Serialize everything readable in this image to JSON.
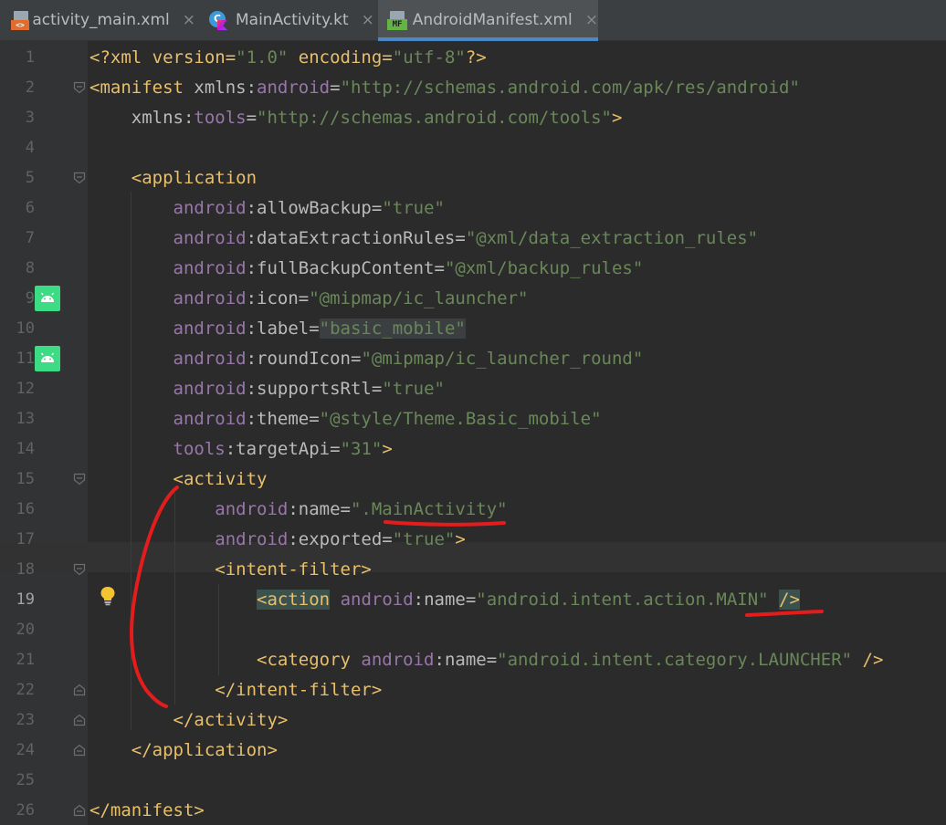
{
  "tabs": [
    {
      "label": "activity_main.xml",
      "icon": "xml-file-icon",
      "closable": true,
      "active": false
    },
    {
      "label": "MainActivity.kt",
      "icon": "kotlin-class-icon",
      "closable": true,
      "active": false
    },
    {
      "label": "AndroidManifest.xml",
      "icon": "manifest-file-icon",
      "closable": true,
      "active": true
    }
  ],
  "close_glyph": "×",
  "editor": {
    "current_line": 19,
    "line_numbers": [
      "1",
      "2",
      "3",
      "4",
      "5",
      "6",
      "7",
      "8",
      "9",
      "10",
      "11",
      "12",
      "13",
      "14",
      "15",
      "16",
      "17",
      "18",
      "19",
      "20",
      "21",
      "22",
      "23",
      "24",
      "25",
      "26"
    ],
    "lines": [
      [
        {
          "c": "pi",
          "t": "<?xml version="
        },
        {
          "c": "val",
          "t": "\"1.0\""
        },
        {
          "c": "pi",
          "t": " encoding="
        },
        {
          "c": "val",
          "t": "\"utf-8\""
        },
        {
          "c": "pi",
          "t": "?>"
        }
      ],
      [
        {
          "c": "tag",
          "t": "<manifest "
        },
        {
          "c": "attr",
          "t": "xmlns:"
        },
        {
          "c": "ns",
          "t": "android"
        },
        {
          "c": "attr",
          "t": "="
        },
        {
          "c": "val",
          "t": "\"http://schemas.android.com/apk/res/android\""
        }
      ],
      [
        {
          "c": "attr",
          "t": "    xmlns:"
        },
        {
          "c": "ns",
          "t": "tools"
        },
        {
          "c": "attr",
          "t": "="
        },
        {
          "c": "val",
          "t": "\"http://schemas.android.com/tools\""
        },
        {
          "c": "tag",
          "t": ">"
        }
      ],
      [],
      [
        {
          "c": "tag",
          "t": "    <application"
        }
      ],
      [
        {
          "c": "ns",
          "t": "        android"
        },
        {
          "c": "attr",
          "t": ":allowBackup="
        },
        {
          "c": "val",
          "t": "\"true\""
        }
      ],
      [
        {
          "c": "ns",
          "t": "        android"
        },
        {
          "c": "attr",
          "t": ":dataExtractionRules="
        },
        {
          "c": "val",
          "t": "\"@xml/data_extraction_rules\""
        }
      ],
      [
        {
          "c": "ns",
          "t": "        android"
        },
        {
          "c": "attr",
          "t": ":fullBackupContent="
        },
        {
          "c": "val",
          "t": "\"@xml/backup_rules\""
        }
      ],
      [
        {
          "c": "ns",
          "t": "        android"
        },
        {
          "c": "attr",
          "t": ":icon="
        },
        {
          "c": "val",
          "t": "\"@mipmap/ic_launcher\""
        }
      ],
      [
        {
          "c": "ns",
          "t": "        android"
        },
        {
          "c": "attr",
          "t": ":label="
        },
        {
          "c": "valbox",
          "t": "\"basic_mobile\""
        }
      ],
      [
        {
          "c": "ns",
          "t": "        android"
        },
        {
          "c": "attr",
          "t": ":roundIcon="
        },
        {
          "c": "val",
          "t": "\"@mipmap/ic_launcher_round\""
        }
      ],
      [
        {
          "c": "ns",
          "t": "        android"
        },
        {
          "c": "attr",
          "t": ":supportsRtl="
        },
        {
          "c": "val",
          "t": "\"true\""
        }
      ],
      [
        {
          "c": "ns",
          "t": "        android"
        },
        {
          "c": "attr",
          "t": ":theme="
        },
        {
          "c": "val",
          "t": "\"@style/Theme.Basic_mobile\""
        }
      ],
      [
        {
          "c": "ns",
          "t": "        tools"
        },
        {
          "c": "attr",
          "t": ":targetApi="
        },
        {
          "c": "val",
          "t": "\"31\""
        },
        {
          "c": "tag",
          "t": ">"
        }
      ],
      [
        {
          "c": "tag",
          "t": "        <activity"
        }
      ],
      [
        {
          "c": "ns",
          "t": "            android"
        },
        {
          "c": "attr",
          "t": ":name="
        },
        {
          "c": "val",
          "t": "\".MainActivity\""
        }
      ],
      [
        {
          "c": "ns",
          "t": "            android"
        },
        {
          "c": "attr",
          "t": ":exported="
        },
        {
          "c": "val",
          "t": "\"true\""
        },
        {
          "c": "tag",
          "t": ">"
        }
      ],
      [
        {
          "c": "tag",
          "t": "            <intent-filter>"
        }
      ],
      [
        {
          "c": "plain",
          "t": "                "
        },
        {
          "c": "tagmatch",
          "t": "<action"
        },
        {
          "c": "tag",
          "t": " "
        },
        {
          "c": "ns",
          "t": "android"
        },
        {
          "c": "attr",
          "t": ":name="
        },
        {
          "c": "val",
          "t": "\"android.intent.action.MAIN\""
        },
        {
          "c": "tag",
          "t": " "
        },
        {
          "c": "tagmatch",
          "t": "/>"
        }
      ],
      [],
      [
        {
          "c": "tag",
          "t": "                <category "
        },
        {
          "c": "ns",
          "t": "android"
        },
        {
          "c": "attr",
          "t": ":name="
        },
        {
          "c": "val",
          "t": "\"android.intent.category.LAUNCHER\""
        },
        {
          "c": "tag",
          "t": " />"
        }
      ],
      [
        {
          "c": "tag",
          "t": "            </intent-filter>"
        }
      ],
      [
        {
          "c": "tag",
          "t": "        </activity>"
        }
      ],
      [
        {
          "c": "tag",
          "t": "    </application>"
        }
      ],
      [],
      [
        {
          "c": "tag",
          "t": "</manifest>"
        }
      ]
    ]
  },
  "gutter_marks": {
    "android_icon_lines": [
      9,
      11
    ],
    "fold_open_lines": [
      2,
      5,
      15,
      18
    ],
    "fold_close_lines": [
      22,
      23,
      24,
      26
    ],
    "bulb_line": 19
  },
  "colors": {
    "background": "#2b2b2b",
    "gutter": "#313335",
    "tag": "#e8bf6a",
    "namespace": "#9876aa",
    "attribute": "#bababa",
    "value": "#6a8759",
    "annotation_red": "#e51c1c",
    "android_green": "#3ddc84"
  }
}
